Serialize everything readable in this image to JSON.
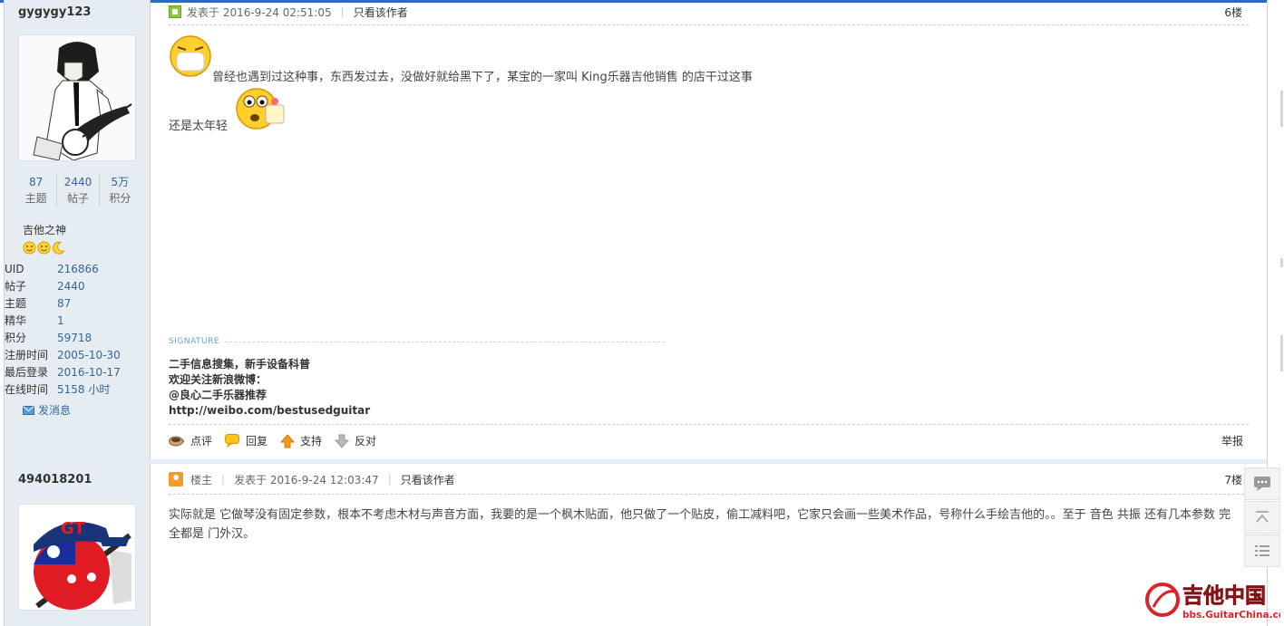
{
  "post1": {
    "username": "gygygy123",
    "stats": [
      {
        "num": "87",
        "label": "主题"
      },
      {
        "num": "2440",
        "label": "帖子"
      },
      {
        "num": "5万",
        "label": "积分"
      }
    ],
    "rank_title": "吉他之神",
    "profile": [
      {
        "key": "UID",
        "val": "216866"
      },
      {
        "key": "帖子",
        "val": "2440"
      },
      {
        "key": "主题",
        "val": "87"
      },
      {
        "key": "精华",
        "val": "1"
      },
      {
        "key": "积分",
        "val": "59718"
      },
      {
        "key": "注册时间",
        "val": "2005-10-30"
      },
      {
        "key": "最后登录",
        "val": "2016-10-17"
      },
      {
        "key": "在线时间",
        "val": "5158 小时"
      }
    ],
    "send_message": "发消息",
    "posted_at": "发表于 2016-9-24 02:51:05",
    "only_author": "只看该作者",
    "floor": "6楼",
    "content_line1": "曾经也遇到过这种事，东西发过去，没做好就给黑下了，某宝的一家叫 King乐器吉他销售 的店干过这事",
    "content_line2": "还是太年轻",
    "signature_label": "SIGNATURE",
    "signature_lines": [
      "二手信息搜集，新手设备科普",
      "欢迎关注新浪微博：",
      "@良心二手乐器推荐",
      "http://weibo.com/bestusedguitar"
    ],
    "actions": {
      "comment": "点评",
      "reply": "回复",
      "support": "支持",
      "oppose": "反对",
      "report": "举报"
    }
  },
  "post2": {
    "username": "494018201",
    "op_label": "楼主",
    "posted_at": "发表于 2016-9-24 12:03:47",
    "only_author": "只看该作者",
    "floor": "7楼",
    "content": "实际就是 它做琴没有固定参数，根本不考虑木材与声音方面，我要的是一个枫木贴面，他只做了一个贴皮，偷工减料吧，它家只会画一些美术作品，号称什么手绘吉他的。。至于 音色 共振 还有几本参数 完全都是 门外汉。"
  },
  "logo": {
    "name": "吉他中国",
    "url": "bbs.GuitarChina.com"
  },
  "colors": {
    "sidebar_bg": "#e5edf2",
    "link_blue": "#336699",
    "top_bar": "#2b6bbd"
  }
}
